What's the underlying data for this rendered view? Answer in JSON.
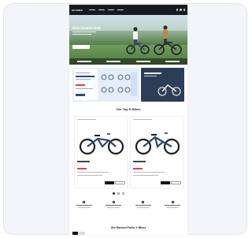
{
  "header": {
    "logo_text": "HEYBIKE"
  },
  "hero": {
    "title": "Ride Smarter Now"
  },
  "sections": {
    "top_title": "Our Top E-Bikes",
    "bottom_title": "Ufo Ranked Fuller Y Bikes"
  },
  "colors": {
    "accent": "#e2403b",
    "nav_bg": "#171a20",
    "bike_frame": "#2f4666"
  }
}
